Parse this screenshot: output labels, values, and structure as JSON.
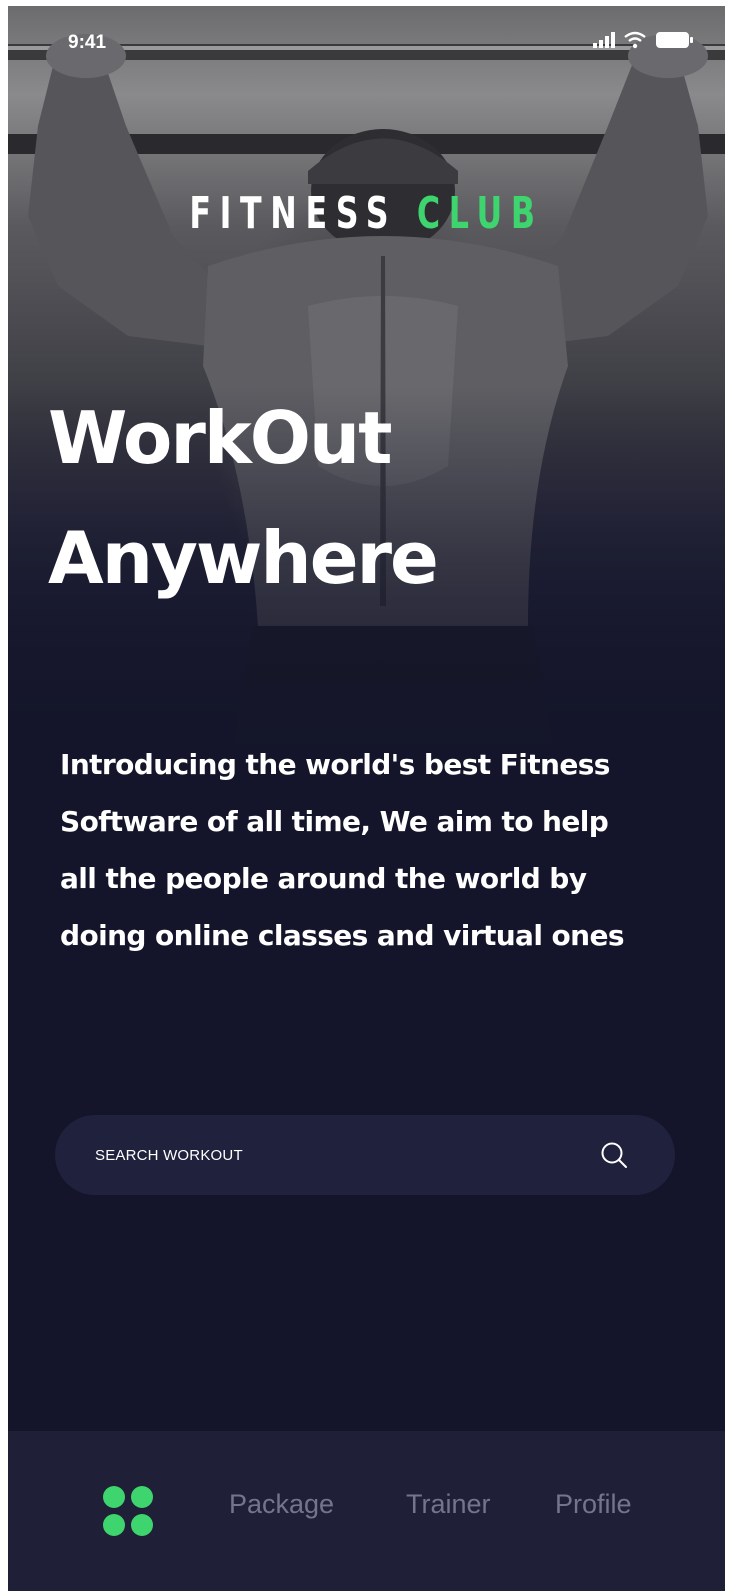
{
  "status_bar": {
    "time": "9:41"
  },
  "brand": {
    "logo_part1": "FITNESS",
    "logo_part2": "CLUB",
    "accent_color": "#3ed46e"
  },
  "hero": {
    "headline_line1": "WorkOut",
    "headline_line2": "Anywhere"
  },
  "intro": {
    "lines": [
      "Introducing the world's best Fitness",
      "Software of all time, We aim to help",
      "all the people around the world by",
      "doing online classes and virtual ones"
    ]
  },
  "search": {
    "placeholder": "SEARCH WORKOUT",
    "value": "",
    "icon": "search-icon"
  },
  "nav": {
    "home_icon": "grid-dots-icon",
    "items": [
      {
        "label": "Package"
      },
      {
        "label": "Trainer"
      },
      {
        "label": "Profile"
      }
    ]
  },
  "colors": {
    "background": "#14152a",
    "search_bg": "#20223d",
    "nav_bg": "#1f2038",
    "nav_text": "#74758a"
  }
}
